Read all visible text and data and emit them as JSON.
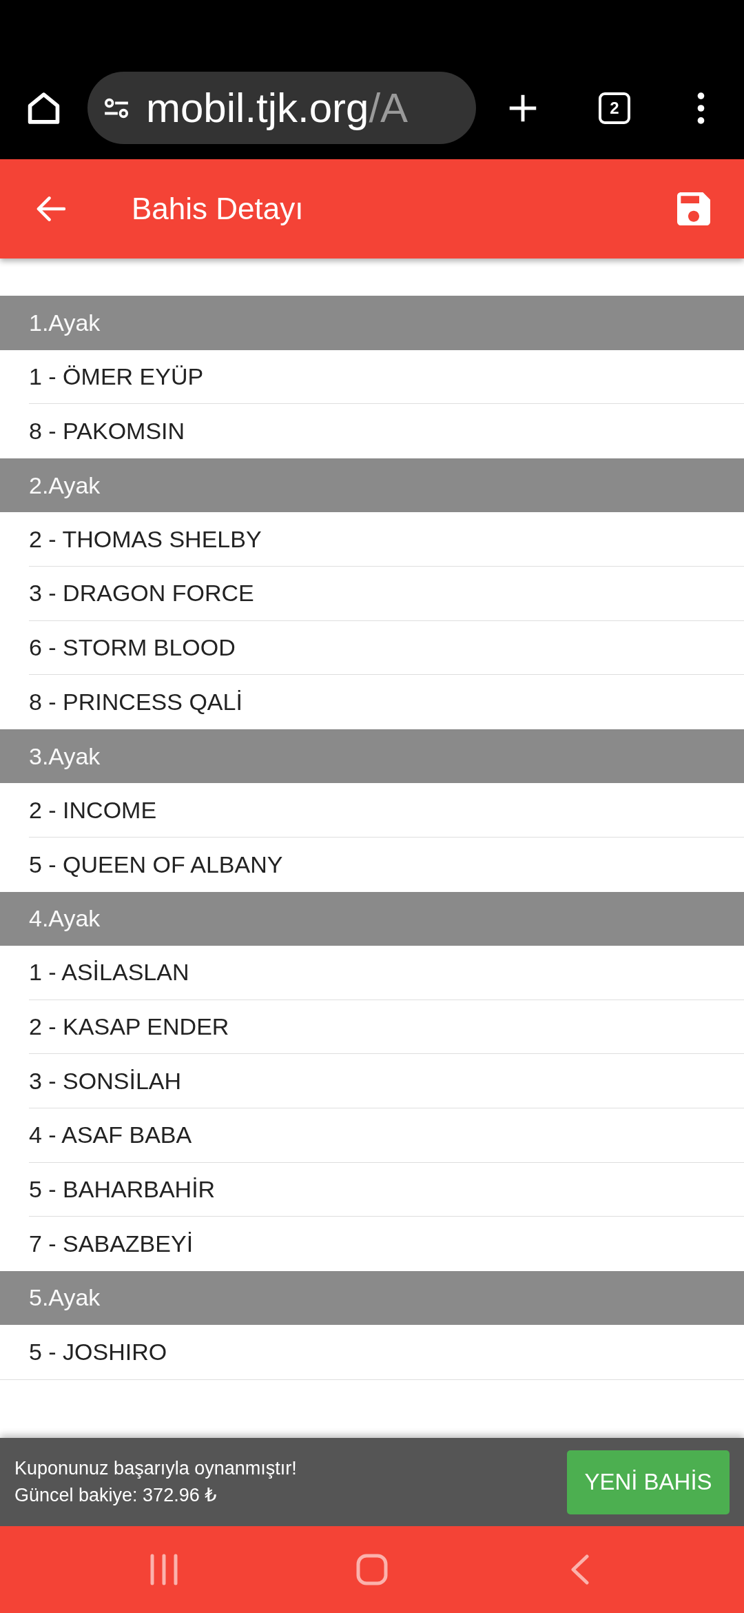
{
  "browser_toolbar": {
    "url": {
      "host": "mobil.tjk.org",
      "path": "/A"
    },
    "tab_count": "2"
  },
  "app_bar": {
    "title": "Bahis Detayı"
  },
  "legs": [
    {
      "title": "1.Ayak",
      "horses": [
        "1 - ÖMER EYÜP",
        "8 - PAKOMSIN"
      ]
    },
    {
      "title": "2.Ayak",
      "horses": [
        "2 - THOMAS SHELBY",
        "3 - DRAGON FORCE",
        "6 - STORM BLOOD",
        "8 - PRINCESS QALİ"
      ]
    },
    {
      "title": "3.Ayak",
      "horses": [
        "2 - INCOME",
        "5 - QUEEN OF ALBANY"
      ]
    },
    {
      "title": "4.Ayak",
      "horses": [
        "1 - ASİLASLAN",
        "2 - KASAP ENDER",
        "3 - SONSİLAH",
        "4 - ASAF BABA",
        "5 - BAHARBAHİR",
        "7 - SABAZBEYİ"
      ]
    },
    {
      "title": "5.Ayak",
      "horses": [
        "5 - JOSHIRO"
      ]
    }
  ],
  "snackbar": {
    "message": "Kuponunuz başarıyla oynanmıştır!",
    "balance": "Güncel bakiye: 372.96 ₺",
    "action": "YENİ BAHİS"
  }
}
